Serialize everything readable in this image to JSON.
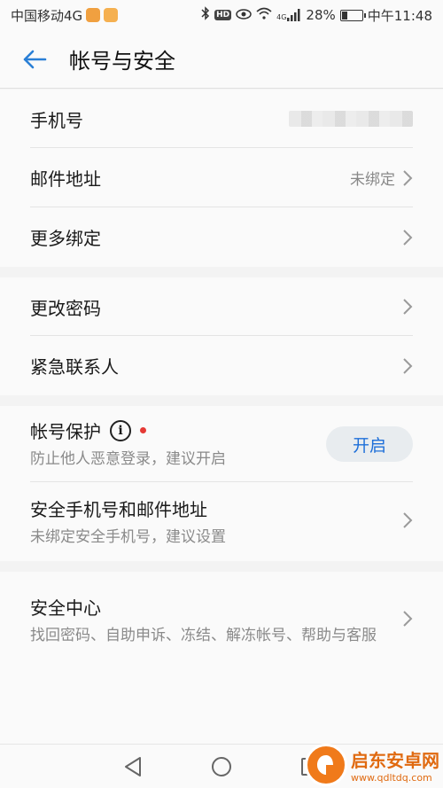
{
  "status_bar": {
    "carrier": "中国移动4G",
    "battery": "28%",
    "time": "中午11:48",
    "hd_label": "HD",
    "network_sup": "4G"
  },
  "header": {
    "title": "帐号与安全"
  },
  "group1": {
    "phone": {
      "label": "手机号"
    },
    "email": {
      "label": "邮件地址",
      "value": "未绑定"
    },
    "more_bind": {
      "label": "更多绑定"
    }
  },
  "group2": {
    "change_password": {
      "label": "更改密码"
    },
    "emergency_contact": {
      "label": "紧急联系人"
    }
  },
  "group3": {
    "account_protection": {
      "label": "帐号保护",
      "info_glyph": "i",
      "sub": "防止他人恶意登录，建议开启",
      "button": "开启"
    },
    "secure_phone_email": {
      "label": "安全手机号和邮件地址",
      "sub": "未绑定安全手机号，建议设置"
    }
  },
  "group4": {
    "security_center": {
      "label": "安全中心",
      "sub": "找回密码、自助申诉、冻结、解冻帐号、帮助与客服"
    }
  },
  "watermark": {
    "title": "启东安卓网",
    "url": "www.qdltdq.com"
  },
  "colors": {
    "accent": "#1e6fd9",
    "back_arrow": "#2a7fd6",
    "red_dot": "#e53935"
  }
}
